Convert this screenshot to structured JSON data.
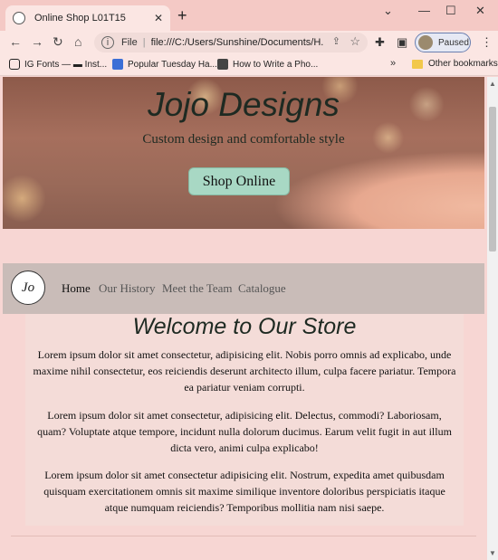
{
  "browser": {
    "tab_title": "Online Shop L01T15",
    "tab_close": "✕",
    "new_tab": "+",
    "window_controls": {
      "collapse": "⌄",
      "minimize": "—",
      "maximize": "☐",
      "close": "✕"
    },
    "nav": {
      "back": "←",
      "forward": "→",
      "reload": "↻",
      "home": "⌂"
    },
    "omnibox": {
      "info": "i",
      "scheme_label": "File",
      "url": "file:///C:/Users/Sunshine/Documents/H..."
    },
    "profile_status": "Paused",
    "bookmarks": [
      {
        "label": "IG Fonts — ▬ Inst...",
        "icon": "instagram-icon",
        "color": "#222222"
      },
      {
        "label": "Popular Tuesday Ha...",
        "icon": "hashtag-icon",
        "color": "#3b6fd6"
      },
      {
        "label": "How to Write a Pho...",
        "icon": "video-icon",
        "color": "#444444"
      }
    ],
    "bookmarks_more": "»",
    "other_bookmarks": "Other bookmarks"
  },
  "page": {
    "hero": {
      "title": "Jojo Designs",
      "subtitle": "Custom design and comfortable style",
      "cta_label": "Shop Online"
    },
    "nav": {
      "logo_text": "Jo",
      "links": [
        "Home",
        "Our History",
        "Meet the Team",
        "Catalogue"
      ],
      "active": "Home"
    },
    "welcome": {
      "title": "Welcome to Our Store",
      "paragraphs": [
        "Lorem ipsum dolor sit amet consectetur, adipisicing elit. Nobis porro omnis ad explicabo, unde maxime nihil consectetur, eos reiciendis deserunt architecto illum, culpa facere pariatur. Tempora ea pariatur veniam corrupti.",
        "Lorem ipsum dolor sit amet consectetur, adipisicing elit. Delectus, commodi? Laboriosam, quam? Voluptate atque tempore, incidunt nulla dolorum ducimus. Earum velit fugit in aut illum dicta vero, animi culpa explicabo!",
        "Lorem ipsum dolor sit amet consectetur adipisicing elit. Nostrum, expedita amet quibusdam quisquam exercitationem omnis sit maxime similique inventore doloribus perspiciatis itaque atque numquam reiciendis? Temporibus mollitia nam nisi saepe."
      ]
    }
  },
  "colors": {
    "page_background": "#f7d6d3",
    "navbar_background": "#c9bcb8",
    "button_background": "#a8d8c4",
    "heading_color": "#1e2a22"
  }
}
